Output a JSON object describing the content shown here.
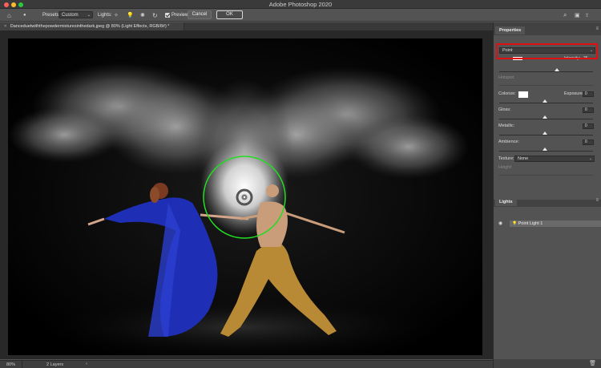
{
  "window": {
    "title": "Adobe Photoshop 2020"
  },
  "options_bar": {
    "presets_label": "Presets:",
    "preset_value": "Custom",
    "lights_label": "Lights:",
    "preview_label": "Preview",
    "cancel_label": "Cancel",
    "ok_label": "OK"
  },
  "document": {
    "tab_title": "Danceduetwiththepowdermixturesinthedark.jpeg @ 80% (Light Effects, RGB/8#) *",
    "close_glyph": "×"
  },
  "status_bar": {
    "zoom": "80%",
    "layers": "2 Layers",
    "arrow": "›"
  },
  "properties": {
    "tab_label": "Properties",
    "light_type": "Point",
    "intensity_label": "Intensity:",
    "intensity_value": "35",
    "hotspot_label": "Hotspot:",
    "colorize_label": "Colorize:",
    "exposure_label": "Exposure:",
    "exposure_value": "0",
    "gloss_label": "Gloss:",
    "gloss_value": "0",
    "metallic_label": "Metallic:",
    "metallic_value": "0",
    "ambience_label": "Ambience:",
    "ambience_value": "0",
    "texture_label": "Texture:",
    "texture_value": "None",
    "height_label": "Height:"
  },
  "lights_panel": {
    "tab_label": "Lights",
    "light_name": "Point Light 1"
  },
  "colors": {
    "light_ring": "#22dd22",
    "highlight_box": "#e01010",
    "dress": "#1f2fb5",
    "trousers": "#b98a35"
  }
}
